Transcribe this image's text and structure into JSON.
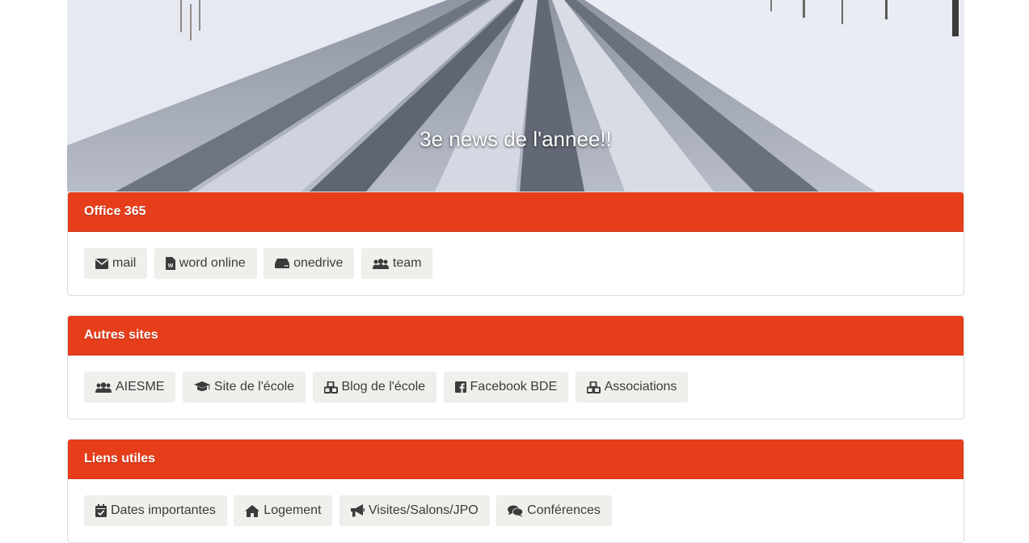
{
  "hero": {
    "caption": "3e news de l'annee!!"
  },
  "panels": [
    {
      "title": "Office 365",
      "buttons": [
        {
          "label": "mail",
          "icon": "envelope-icon"
        },
        {
          "label": "word online",
          "icon": "word-file-icon"
        },
        {
          "label": "onedrive",
          "icon": "hdd-icon"
        },
        {
          "label": "team",
          "icon": "users-icon"
        }
      ]
    },
    {
      "title": "Autres sites",
      "buttons": [
        {
          "label": "AIESME",
          "icon": "users-icon"
        },
        {
          "label": "Site de l'école",
          "icon": "graduation-cap-icon"
        },
        {
          "label": "Blog de l'école",
          "icon": "cubes-icon"
        },
        {
          "label": "Facebook BDE",
          "icon": "facebook-icon"
        },
        {
          "label": "Associations",
          "icon": "cubes-icon"
        }
      ]
    },
    {
      "title": "Liens utiles",
      "buttons": [
        {
          "label": "Dates importantes",
          "icon": "calendar-check-icon"
        },
        {
          "label": "Logement",
          "icon": "home-icon"
        },
        {
          "label": "Visites/Salons/JPO",
          "icon": "bullhorn-icon"
        },
        {
          "label": "Conférences",
          "icon": "comments-icon"
        }
      ]
    }
  ],
  "colors": {
    "panel_header": "#e63d1b",
    "button_bg": "#f1efec",
    "button_text": "#3b3b3b"
  }
}
